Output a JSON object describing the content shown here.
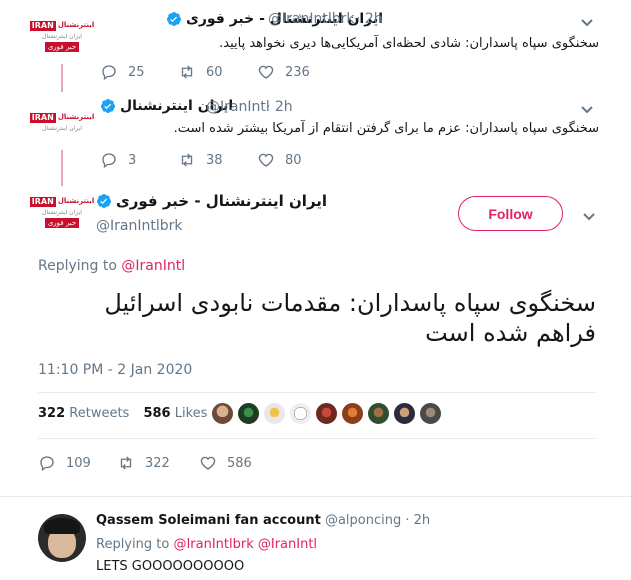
{
  "tweet1": {
    "name": "ایران اینترنشنال - خبر فوری",
    "handle": "@IranIntlbrk",
    "time": "· 2h",
    "text": "سخنگوی سپاه پاسداران: شادی لحظه‌ای آمریکایی‌ها دیری نخواهد پایید.",
    "replies": "25",
    "retweets": "60",
    "likes": "236"
  },
  "tweet2": {
    "name": "ایران اینترنشنال",
    "handle": "@IranIntl",
    "time": "· 2h",
    "text": "سخنگوی سپاه پاسداران: عزم ما برای گرفتن انتقام از آمریکا بیشتر شده است.",
    "replies": "3",
    "retweets": "38",
    "likes": "80"
  },
  "main": {
    "name": "ایران اینترنشنال - خبر فوری",
    "handle": "@IranIntlbrk",
    "follow_label": "Follow",
    "replying_label": "Replying to",
    "replying_handle": "@IranIntl",
    "text_line1": "سخنگوی سپاه پاسداران: مقدمات نابودی اسرائیل",
    "text_line2": "فراهم شده است",
    "timestamp": "11:10 PM - 2 Jan 2020",
    "retweet_count": "322",
    "retweet_label": "Retweets",
    "like_count": "586",
    "like_label": "Likes",
    "replies": "109",
    "retweets": "322",
    "likes": "586"
  },
  "reply": {
    "name": "Qassem Soleimani fan account",
    "handle": "@alponcing",
    "time": "· 2h",
    "replying_label": "Replying to",
    "replying_handles": "@IranIntlbrk @IranIntl",
    "text": "LETS GOOOOOOOOOO"
  },
  "logo": {
    "brand": "IRAN",
    "brand_fa": "اینترنشنال",
    "sub": "ایران اینترنشنال",
    "badge": "خبر فوری"
  },
  "colors": {
    "accent": "#1da1f2",
    "follow": "#e0245e",
    "brand_red": "#c8102e",
    "thread_line": "#e8a7b4"
  }
}
